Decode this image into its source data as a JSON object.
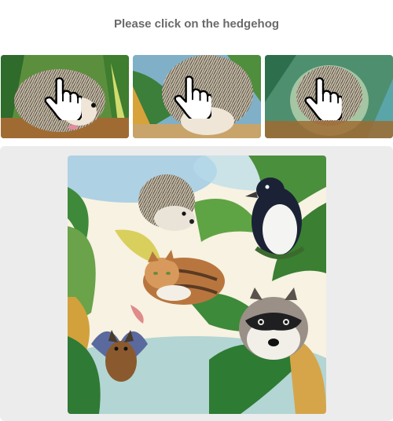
{
  "captcha": {
    "prompt": "Please click on the hedgehog",
    "examples": [
      {
        "icon": "hand-pointer-icon"
      },
      {
        "icon": "hand-pointer-icon"
      },
      {
        "icon": "hand-pointer-icon"
      }
    ],
    "scene_animals": [
      "hedgehog",
      "penguin",
      "cat",
      "raccoon",
      "bat"
    ]
  }
}
